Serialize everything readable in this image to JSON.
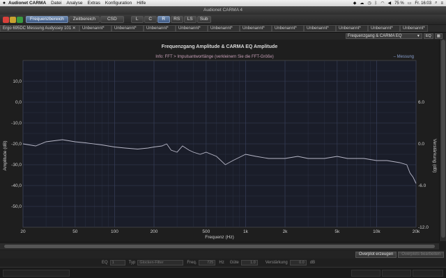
{
  "menubar": {
    "app": "Audionet CARMA",
    "items": [
      "Datei",
      "Analyse",
      "Extras",
      "Konfiguration",
      "Hilfe"
    ],
    "battery": "75 %",
    "clock": "Fr. 16:03"
  },
  "window": {
    "title": "Audionet CARMA 4"
  },
  "toolbar": {
    "tabs": [
      "Frequenzbereich",
      "Zeitbereich",
      "CSD"
    ],
    "channels": [
      "L",
      "C",
      "R",
      "RS",
      "LS",
      "Sub"
    ]
  },
  "documents": [
    "Ergo 695DC Messung Audyssey 101 ✕",
    "Unbenannt*",
    "Unbenannt*",
    "Unbenannt*",
    "Unbenannt*",
    "Unbenannt*",
    "Unbenannt*",
    "Unbenannt*",
    "Unbenannt*",
    "Unbenannt*",
    "Unbenannt*",
    "Unbenannt*"
  ],
  "view": {
    "selector": "Frequenzgang & CARMA EQ",
    "eq_button": "EQ"
  },
  "chart_data": {
    "type": "line",
    "title": "Frequenzgang Amplitude & CARMA EQ Amplitude",
    "info": "Info: FFT > Impulsantwortlänge (verkleinern Sie die FFT-Größe)",
    "legend": "Messung",
    "legend_position": "top-right",
    "xlabel": "Frequenz (Hz)",
    "ylabel": "Amplitude (dB)",
    "y2label": "Verstärkung (dB)",
    "x_scale": "log",
    "xlim": [
      20,
      20000
    ],
    "ylim": [
      -60,
      20
    ],
    "y2lim": [
      -12,
      12
    ],
    "grid": true,
    "x_ticks": [
      20,
      50,
      100,
      200,
      500,
      1000,
      2000,
      5000,
      10000,
      20000
    ],
    "x_tick_labels": [
      "20",
      "50",
      "100",
      "200",
      "500",
      "1k",
      "2k",
      "5k",
      "10k",
      "20k"
    ],
    "y_ticks": [
      10,
      0,
      -10,
      -20,
      -30,
      -40,
      -50
    ],
    "y_tick_labels": [
      "10,0",
      "0,0",
      "-10,0",
      "-20,0",
      "-30,0",
      "-40,0",
      "-50,0"
    ],
    "y2_ticks": [
      6,
      0,
      -6,
      -12
    ],
    "y2_tick_labels": [
      "6.0",
      "0.0",
      "-6.0",
      "-12.0"
    ],
    "series": [
      {
        "name": "Messung",
        "color": "#b8b8c8",
        "x": [
          20,
          25,
          30,
          40,
          50,
          60,
          80,
          100,
          120,
          150,
          180,
          200,
          230,
          250,
          270,
          300,
          330,
          370,
          400,
          450,
          500,
          600,
          700,
          800,
          1000,
          1200,
          1500,
          2000,
          2500,
          3000,
          4000,
          5000,
          6000,
          8000,
          10000,
          12000,
          15000,
          17000,
          18000,
          19000,
          20000
        ],
        "values": [
          -20,
          -21,
          -19,
          -18,
          -19,
          -19.5,
          -20.5,
          -21.5,
          -22,
          -22.5,
          -22,
          -21.5,
          -21,
          -20,
          -23,
          -24,
          -21,
          -23,
          -24,
          -25,
          -24,
          -26,
          -30,
          -28,
          -25,
          -26,
          -27,
          -27,
          -26,
          -27,
          -27,
          -26,
          -27,
          -27,
          -28,
          -28,
          -29,
          -30,
          -34,
          -36,
          -39
        ]
      }
    ]
  },
  "scroll": {},
  "actions": {
    "overplot": "Overplot erzeugen",
    "overplot_edit": "Overplots bearbeiten"
  },
  "eq": {
    "eq_label": "EQ",
    "eq_value": "1",
    "type_label": "Typ",
    "type_value": "Glocken-Filter",
    "freq_label": "Freq.",
    "freq_value": "725",
    "freq_unit": "Hz",
    "q_label": "Güte",
    "q_value": "1.0",
    "gain_label": "Verstärkung",
    "gain_value": "0.0",
    "gain_unit": "dB"
  }
}
